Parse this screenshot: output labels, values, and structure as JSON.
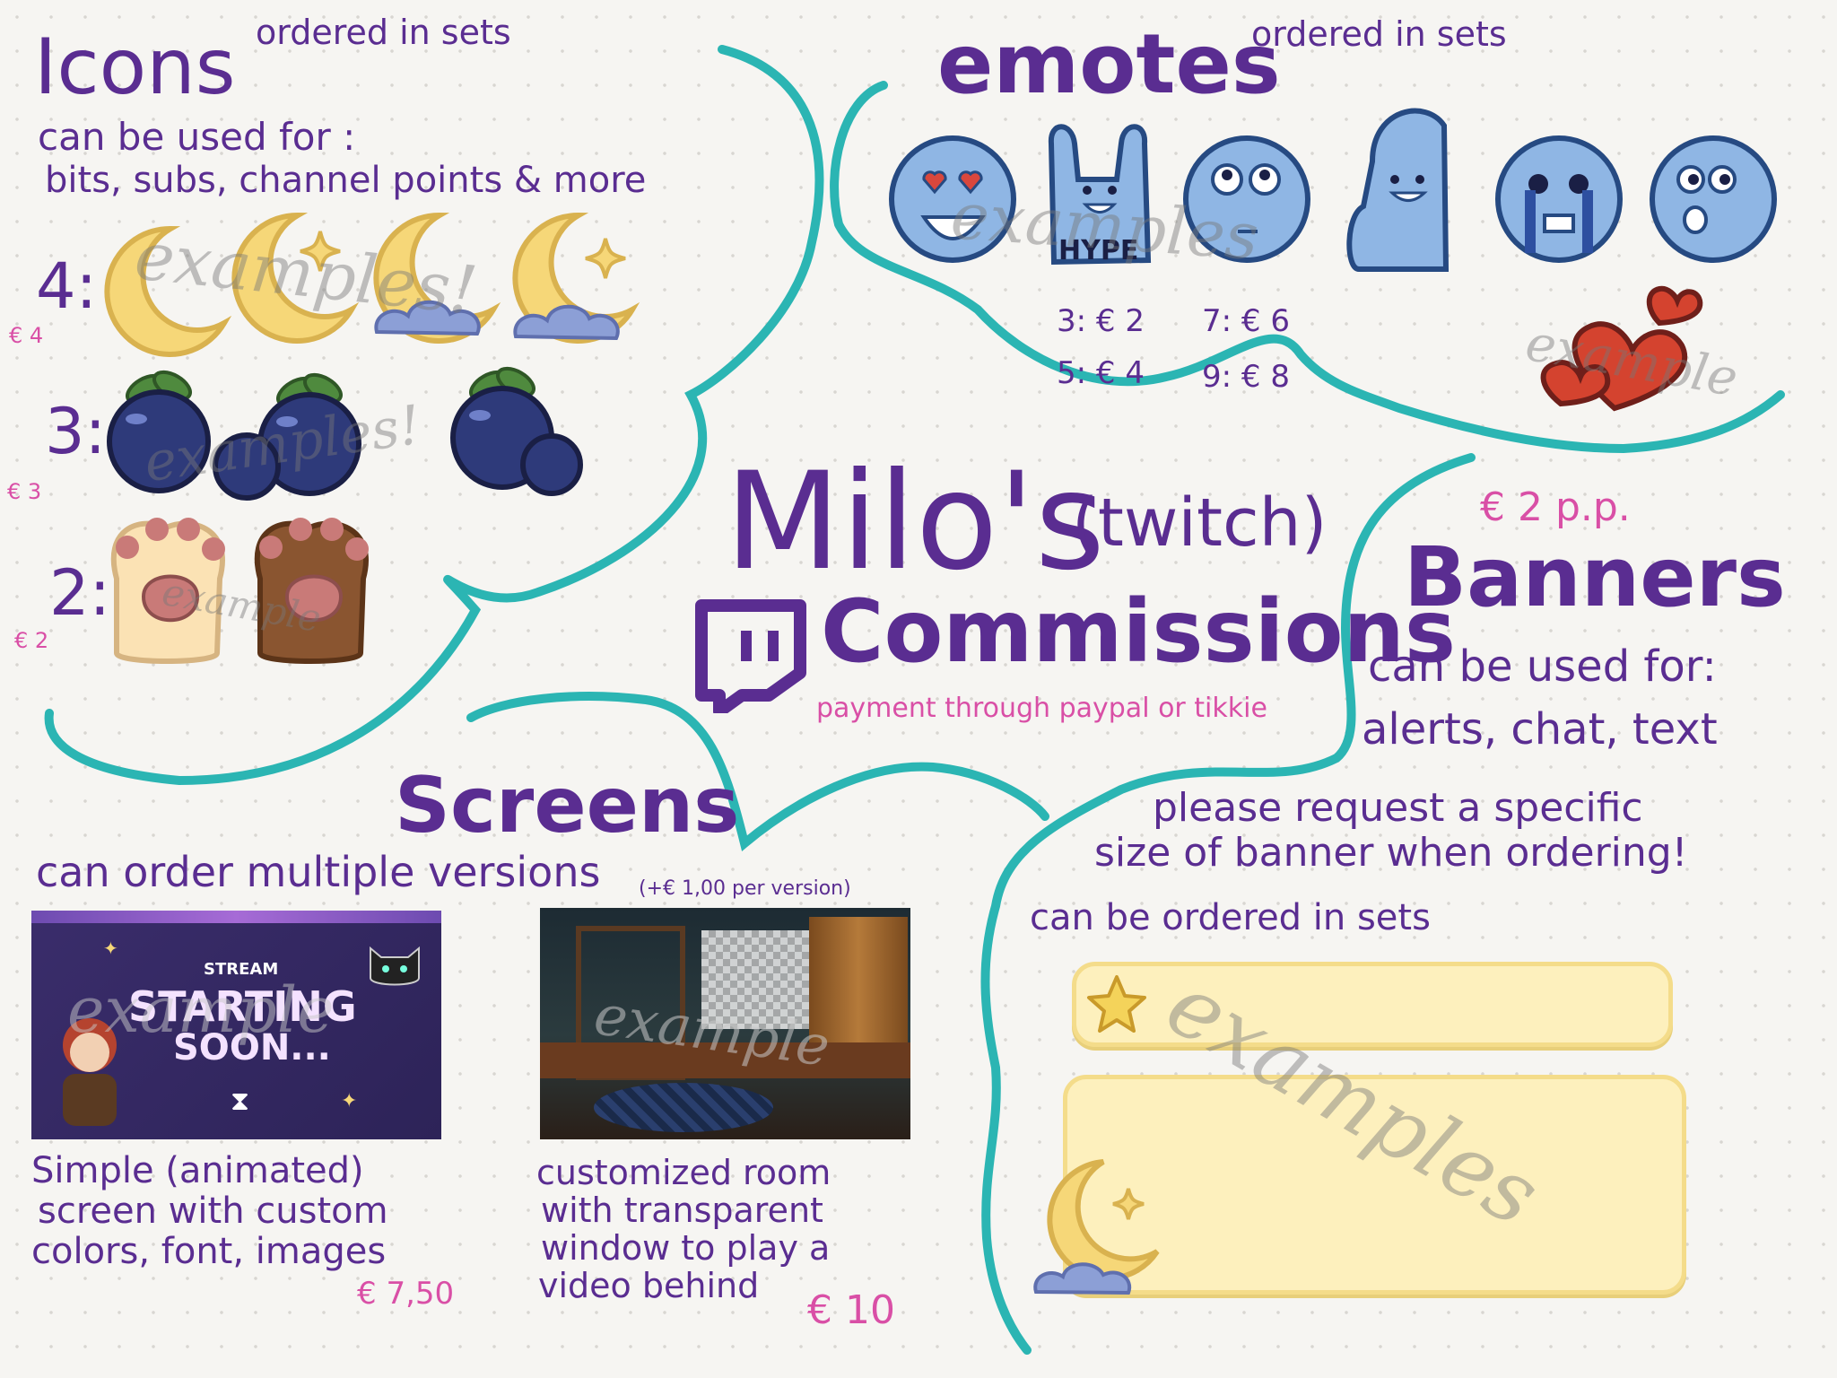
{
  "icons": {
    "title": "Icons",
    "note": "ordered in sets",
    "usage_line1": "can be used for :",
    "usage_line2": "bits, subs, channel points & more",
    "row4_label": "4:",
    "row4_price": "€ 4",
    "row3_label": "3:",
    "row3_price": "€ 3",
    "row2_label": "2:",
    "row2_price": "€ 2",
    "watermark1": "examples!",
    "watermark2": "examples!",
    "watermark3": "example"
  },
  "emotes": {
    "title": "emotes",
    "note": "ordered in sets",
    "hype_text": "HYPE",
    "price_3": "3: € 2",
    "price_5": "5: € 4",
    "price_7": "7: € 6",
    "price_9": "9: € 8",
    "watermark": "examples",
    "heart_watermark": "example"
  },
  "center": {
    "title": "Milo's",
    "subtitle": "(twitch)",
    "commissions": "Commissions",
    "payment": "payment through paypal or tikkie"
  },
  "banners": {
    "price": "€ 2 p.p.",
    "title": "Banners",
    "usage_line1": "can be used for:",
    "usage_line2": "alerts, chat, text",
    "request_line1": "please request a specific",
    "request_line2": "size of banner when ordering!",
    "sets_note": "can be ordered in sets",
    "watermark": "examples"
  },
  "screens": {
    "title": "Screens",
    "usage": "can order multiple versions",
    "extra_price": "(+€ 1,00 per version)",
    "screen1_small": "STREAM",
    "screen1_big1": "STARTING",
    "screen1_big2": "SOON...",
    "screen1_watermark": "example",
    "screen1_desc1": "Simple (animated)",
    "screen1_desc2": "screen with custom",
    "screen1_desc3": "colors, font, images",
    "screen1_price": "€ 7,50",
    "screen2_watermark": "example",
    "screen2_desc1": "customized room",
    "screen2_desc2": "with transparent",
    "screen2_desc3": "window to play a",
    "screen2_desc4": "video behind",
    "screen2_price": "€ 10"
  },
  "colors": {
    "divider": "#2bb5b3",
    "text": "#5a2d91",
    "price": "#d94fa6",
    "moon": "#f6d778",
    "blueberry": "#2e3a7a",
    "emote": "#8fb6e4"
  },
  "icon_names": [
    "moon-icon",
    "blueberry-icon",
    "paw-icon",
    "emote-face-icon",
    "heart-icon",
    "twitch-logo-icon",
    "star-icon",
    "cloud-icon",
    "cat-icon"
  ]
}
